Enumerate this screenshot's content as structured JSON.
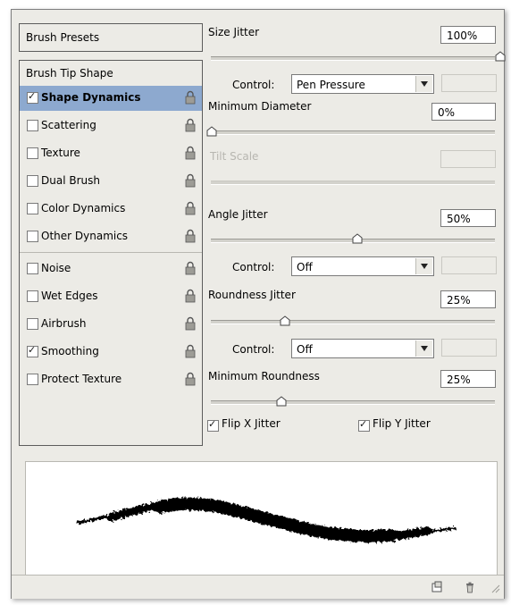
{
  "left": {
    "brush_presets": "Brush Presets",
    "brush_tip_shape": "Brush Tip Shape",
    "items": [
      {
        "label": "Shape Dynamics",
        "checked": true,
        "selected": true
      },
      {
        "label": "Scattering",
        "checked": false
      },
      {
        "label": "Texture",
        "checked": false
      },
      {
        "label": "Dual Brush",
        "checked": false
      },
      {
        "label": "Color Dynamics",
        "checked": false
      },
      {
        "label": "Other Dynamics",
        "checked": false
      },
      {
        "label": "Noise",
        "checked": false
      },
      {
        "label": "Wet Edges",
        "checked": false
      },
      {
        "label": "Airbrush",
        "checked": false
      },
      {
        "label": "Smoothing",
        "checked": true
      },
      {
        "label": "Protect Texture",
        "checked": false
      }
    ]
  },
  "right": {
    "size_jitter": {
      "label": "Size Jitter",
      "value": "100%",
      "level": 100
    },
    "size_control": {
      "label": "Control:",
      "value": "Pen Pressure"
    },
    "minimum_diameter": {
      "label": "Minimum Diameter",
      "value": "0%",
      "level": 0
    },
    "tilt_scale": {
      "label": "Tilt Scale",
      "value": ""
    },
    "angle_jitter": {
      "label": "Angle Jitter",
      "value": "50%",
      "level": 50
    },
    "angle_control": {
      "label": "Control:",
      "value": "Off"
    },
    "roundness_jitter": {
      "label": "Roundness Jitter",
      "value": "25%",
      "level": 25
    },
    "roundness_control": {
      "label": "Control:",
      "value": "Off"
    },
    "minimum_roundness": {
      "label": "Minimum Roundness",
      "value": "25%",
      "level": 25
    },
    "flip_x": {
      "label": "Flip X Jitter",
      "checked": true
    },
    "flip_y": {
      "label": "Flip Y Jitter",
      "checked": true
    }
  },
  "icons": {
    "lock": "lock-icon",
    "new_preset": "new-brush-icon",
    "delete": "trash-icon"
  },
  "colors": {
    "panel_bg": "#ecebe6",
    "selected_bg": "#8da9cf"
  }
}
